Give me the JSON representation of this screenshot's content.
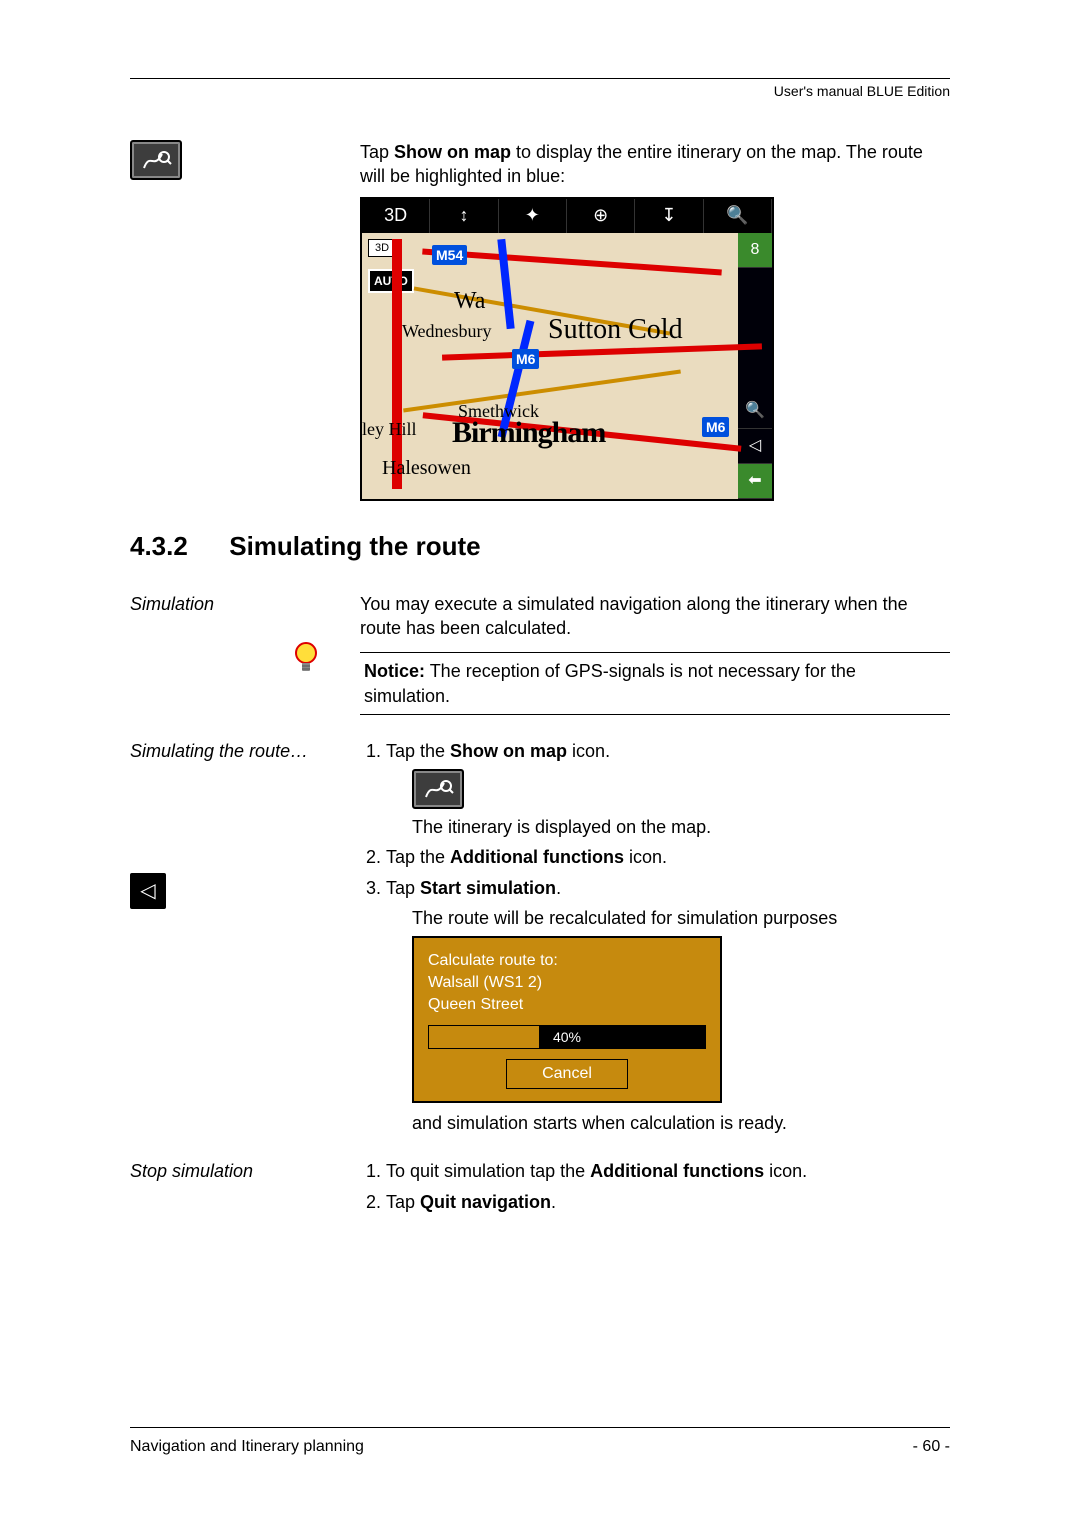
{
  "header": {
    "right": "User's manual BLUE Edition"
  },
  "footer": {
    "left": "Navigation and Itinerary planning",
    "page": "- 60 -"
  },
  "intro": {
    "text_before": "Tap ",
    "text_bold": "Show on map",
    "text_after": " to display the entire itinerary on the map. The route will be highlighted in blue:"
  },
  "map": {
    "toolbar_icons": [
      "3D",
      "↕",
      "✦",
      "⊕",
      "↧",
      "🔍"
    ],
    "rightbar": {
      "top_green": "8",
      "zoom": "🔍",
      "arrow": "◁",
      "bottom_green": "⬅"
    },
    "badge_3d": "3D",
    "auto": "AUTO",
    "motorways": {
      "m54": "M54",
      "m6a": "M6",
      "m6b": "M6"
    },
    "labels": {
      "walsall_prefix": "Wa",
      "wednesbury": "Wednesbury",
      "sutton": "Sutton Cold",
      "smethwick": "Smethwick",
      "leyhill": "ley Hill",
      "bham": "Birmingham",
      "halesowen": "Halesowen"
    }
  },
  "section": {
    "number": "4.3.2",
    "title": "Simulating the route"
  },
  "simulation": {
    "label": "Simulation",
    "text": "You may execute a simulated navigation along the itinerary when the route has been calculated."
  },
  "notice": {
    "bold": "Notice:",
    "text": " The reception of GPS-signals is not necessary for the simulation."
  },
  "simulating": {
    "label": "Simulating the route…",
    "step1_before": "Tap the ",
    "step1_bold": "Show on map",
    "step1_after": " icon.",
    "after_step1": "The itinerary is displayed on the map.",
    "step2_before": "Tap the ",
    "step2_bold": "Additional functions",
    "step2_after": " icon.",
    "step3_before": "Tap ",
    "step3_bold": "Start simulation",
    "step3_after": ".",
    "after_step3": "The route will be recalculated for simulation purposes",
    "after_dialog": "and simulation starts when calculation is ready."
  },
  "dialog": {
    "line1": "Calculate route to:",
    "line2": "Walsall (WS1 2)",
    "line3": "Queen Street",
    "percent": "40%",
    "cancel": "Cancel"
  },
  "stop": {
    "label": "Stop simulation",
    "step1_before": "To quit simulation tap the ",
    "step1_bold": "Additional functions",
    "step1_after": " icon.",
    "step2_before": "Tap ",
    "step2_bold": "Quit navigation",
    "step2_after": "."
  }
}
